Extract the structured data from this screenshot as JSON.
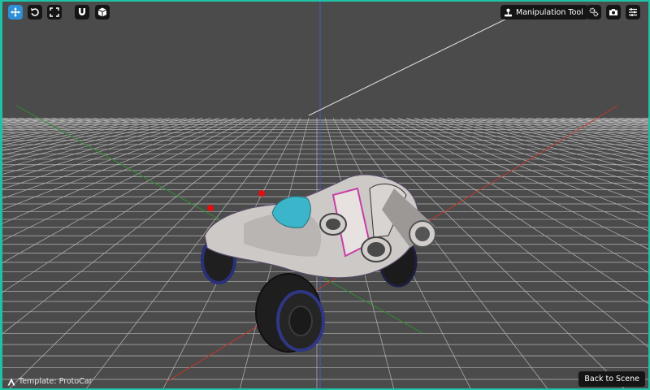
{
  "toolbar": {
    "left_icons": [
      "move-icon",
      "undo-icon",
      "fullscreen-icon",
      "magnet-icon",
      "cube-icon"
    ],
    "tool_label": "Manipulation Tool",
    "right_icons": [
      "settings-icon",
      "camera-icon",
      "sliders-icon"
    ]
  },
  "footer": {
    "template_label": "Template: ProtoCar",
    "back_label": "Back to Scene"
  },
  "colors": {
    "accent": "#1ec3a6",
    "active_button": "#2e8fd6",
    "button_bg": "#151515",
    "viewport_bg": "#4b4b4b",
    "grid_line": "#bdbdbd",
    "axis_x": "#c0392b",
    "axis_y": "#2f8f2f",
    "axis_z": "#4a5bbf",
    "car_body": "#d0ccc8",
    "car_cockpit": "#3bb5c9",
    "marker": "#e01010"
  }
}
